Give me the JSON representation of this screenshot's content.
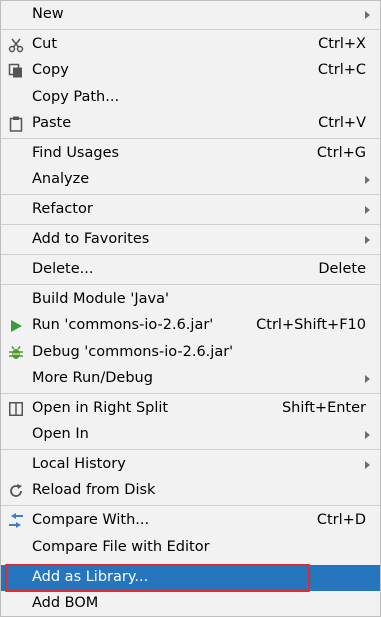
{
  "menu": {
    "items": {
      "new": {
        "label": "New",
        "has_submenu": true
      },
      "cut": {
        "label": "Cut",
        "shortcut": "Ctrl+X",
        "icon": "scissors-icon"
      },
      "copy": {
        "label": "Copy",
        "shortcut": "Ctrl+C",
        "icon": "copy-icon"
      },
      "copy_path": {
        "label": "Copy Path..."
      },
      "paste": {
        "label": "Paste",
        "shortcut": "Ctrl+V",
        "icon": "clipboard-icon"
      },
      "find_usages": {
        "label": "Find Usages",
        "shortcut": "Ctrl+G"
      },
      "analyze": {
        "label": "Analyze",
        "has_submenu": true
      },
      "refactor": {
        "label": "Refactor",
        "has_submenu": true
      },
      "add_to_favorites": {
        "label": "Add to Favorites",
        "has_submenu": true
      },
      "delete": {
        "label": "Delete...",
        "shortcut": "Delete"
      },
      "build_module": {
        "label": "Build Module 'Java'"
      },
      "run": {
        "label": "Run 'commons-io-2.6.jar'",
        "shortcut": "Ctrl+Shift+F10",
        "icon": "run-icon"
      },
      "debug": {
        "label": "Debug 'commons-io-2.6.jar'",
        "icon": "bug-icon"
      },
      "more_run_debug": {
        "label": "More Run/Debug",
        "has_submenu": true
      },
      "open_right_split": {
        "label": "Open in Right Split",
        "shortcut": "Shift+Enter",
        "icon": "split-icon"
      },
      "open_in": {
        "label": "Open In",
        "has_submenu": true
      },
      "local_history": {
        "label": "Local History",
        "has_submenu": true
      },
      "reload_from_disk": {
        "label": "Reload from Disk",
        "icon": "reload-icon"
      },
      "compare_with": {
        "label": "Compare With...",
        "shortcut": "Ctrl+D",
        "icon": "compare-icon"
      },
      "compare_file_editor": {
        "label": "Compare File with Editor"
      },
      "add_as_library": {
        "label": "Add as Library...",
        "selected": true
      },
      "add_bom": {
        "label": "Add BOM"
      }
    }
  },
  "colors": {
    "menu_bg": "#f2f2f2",
    "selected_bg": "#2675bf",
    "highlight_border": "#e02c2c",
    "run_icon": "#3a9c3a",
    "debug_icon": "#4f9a2a",
    "compare_icon": "#3c7ec7"
  }
}
